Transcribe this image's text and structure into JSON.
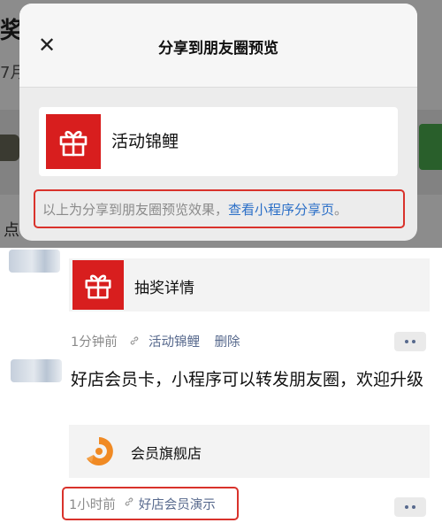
{
  "background": {
    "title_fragment": "奖",
    "date_fragment": "7月",
    "side_fragment": "点"
  },
  "modal": {
    "close_glyph": "✕",
    "title": "分享到朋友圈预览",
    "preview": {
      "icon": "gift-icon",
      "name": "活动锦鲤"
    },
    "note": {
      "text": "以上为分享到朋友圈预览效果，",
      "link": "查看小程序分享页",
      "end": "。"
    }
  },
  "feed": {
    "post1": {
      "card_icon": "gift-icon",
      "card_label": "抽奖详情",
      "time": "1分钟前",
      "app_name": "活动锦鲤",
      "delete_label": "删除"
    },
    "post2": {
      "text": "好店会员卡，小程序可以转发朋友圈，欢迎升级",
      "card_icon": "store-logo-icon",
      "card_label": "会员旗舰店",
      "time": "1小时前",
      "app_name": "好店会员演示"
    }
  },
  "colors": {
    "gift_red": "#d81e1e",
    "link_blue": "#2b6fc7",
    "highlight_red": "#d9322b",
    "meta_blue": "#57698d",
    "logo_orange": "#f08a24"
  }
}
